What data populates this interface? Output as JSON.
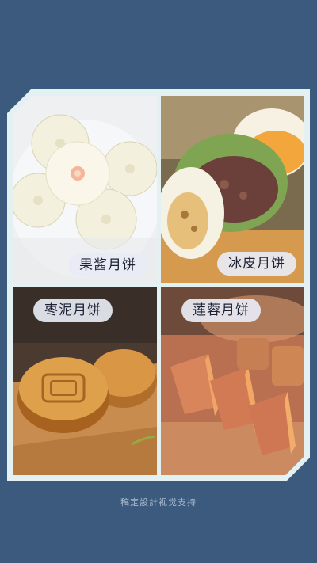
{
  "tiles": [
    {
      "label": "果酱月饼",
      "icon": "jam-mooncake-photo"
    },
    {
      "label": "冰皮月饼",
      "icon": "snowskin-mooncake-photo"
    },
    {
      "label": "枣泥月饼",
      "icon": "date-paste-mooncake-photo"
    },
    {
      "label": "莲蓉月饼",
      "icon": "lotus-paste-mooncake-photo"
    }
  ],
  "footer": {
    "credit": "稿定設計视觉支持"
  },
  "colors": {
    "background": "#3b5a7e",
    "frame": "#e3f1f2",
    "pill": "#e8ecf4"
  }
}
